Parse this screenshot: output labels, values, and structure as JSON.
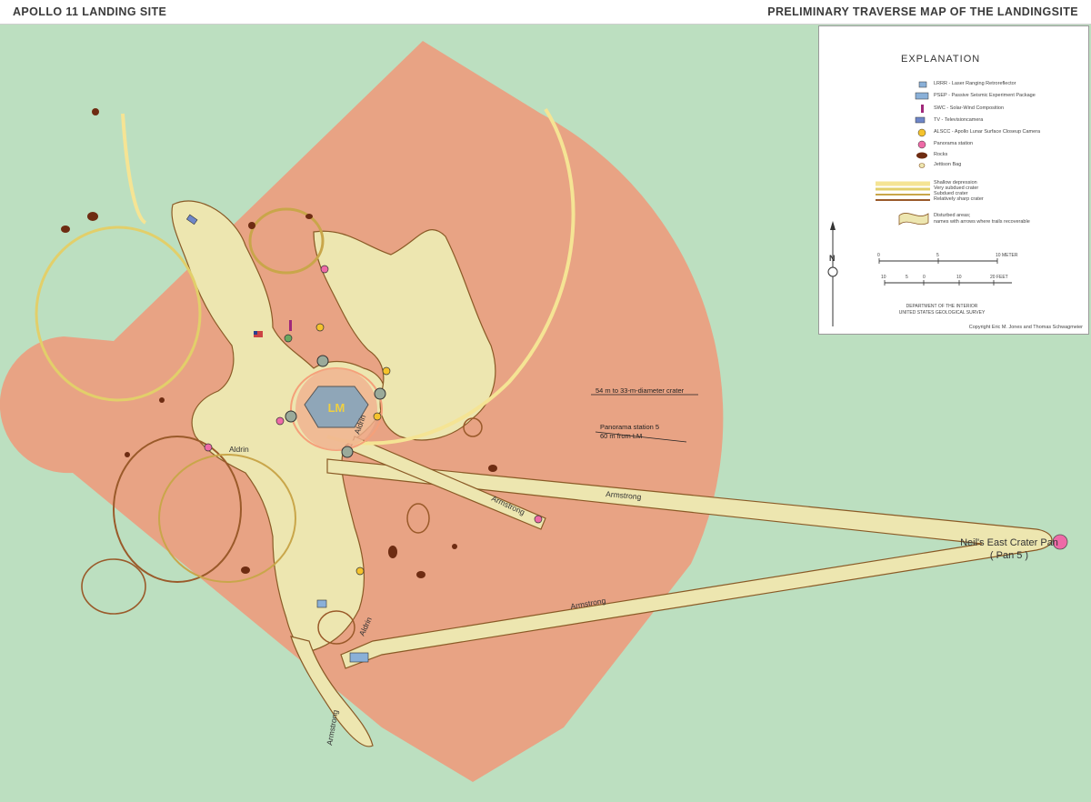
{
  "header": {
    "left_title": "APOLLO 11 LANDING SITE",
    "right_title": "PRELIMINARY TRAVERSE MAP OF THE LANDINGSITE"
  },
  "map": {
    "colors": {
      "background": "#bcdfc0",
      "shaded_zone": "#e8a384",
      "traverse_area": "#ede6b0",
      "trail_stroke": "#8a5a26",
      "shallow_depression": "#f5e494",
      "very_subdued_crater": "#e2cf6a",
      "subdued_crater": "#c9a64a",
      "relatively_sharp_crater": "#9a5a2a",
      "rock": "#6e2c12",
      "lm_body": "#8fa6b8"
    },
    "lm_label": "LM",
    "annotations": {
      "crater_diameter": "54 m to 33-m-diameter crater",
      "pan5_line1": "Panorama station 5",
      "pan5_line2": "60 m from LM",
      "pan5_name_line1": "Neil's East Crater Pan",
      "pan5_name_line2": "( Pan 5 )"
    },
    "trail_labels": {
      "aldrin_1": "Aldrin",
      "aldrin_2": "Aldrin",
      "aldrin_3": "Aldrin",
      "armstrong_1": "Armstrong",
      "armstrong_2": "Armstrong",
      "armstrong_3": "Armstrong",
      "armstrong_4": "Armstrong"
    }
  },
  "legend": {
    "title": "EXPLANATION",
    "items": [
      {
        "label": "LRRR - Laser Ranging Retroreflector",
        "icon": "lrrr-icon"
      },
      {
        "label": "PSEP - Passive Seismic Experiment Package",
        "icon": "psep-icon"
      },
      {
        "label": "SWC - Solar-Wind Composition",
        "icon": "swc-icon"
      },
      {
        "label": "TV - Televisioncamera",
        "icon": "tv-camera-icon"
      },
      {
        "label": "ALSCC - Apollo Lunar Surface Closeup Camera",
        "icon": "alscc-icon"
      },
      {
        "label": "Panorama station",
        "icon": "panorama-icon"
      },
      {
        "label": "Rocks",
        "icon": "rock-icon"
      },
      {
        "label": "Jettison Bag",
        "icon": "jettison-bag-icon"
      }
    ],
    "crater_types": [
      "Shallow depression",
      "Very subdued crater",
      "Subdued crater",
      "Relatively sharp crater"
    ],
    "disturbed_line1": "Disturbed areas;",
    "disturbed_line2": "names with arrows where trails recoverable",
    "north_label": "N",
    "scale_meter": {
      "ticks": [
        "0",
        "5",
        "10 METER"
      ]
    },
    "scale_feet": {
      "ticks": [
        "10",
        "5",
        "0",
        "10",
        "20 FEET"
      ]
    },
    "department_line1": "DEPARTMENT OF THE INTERIOR",
    "department_line2": "UNITED STATES GEOLOGICAL SURVEY",
    "copyright": "Copyright Eric M. Jones and Thomas Schwagmeier"
  }
}
